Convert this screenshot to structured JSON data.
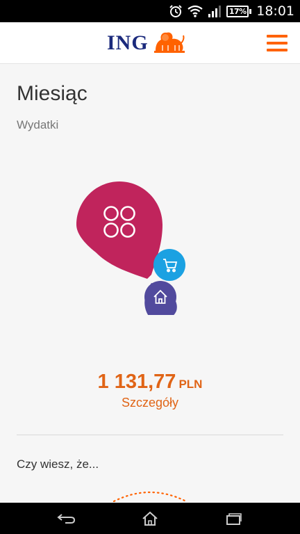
{
  "status_bar": {
    "battery": "17%",
    "time": "18:01",
    "icons": [
      "alarm-icon",
      "wifi-icon",
      "signal-icon",
      "battery-icon"
    ]
  },
  "header": {
    "logo_text": "ING",
    "logo_icon": "lion-icon",
    "menu_icon": "hamburger-icon"
  },
  "main": {
    "title": "Miesiąc",
    "subtitle": "Wydatki",
    "categories": [
      {
        "icon": "grid-icon",
        "color": "#c0245c"
      },
      {
        "icon": "cart-icon",
        "color": "#1ba1e2"
      },
      {
        "icon": "home-icon",
        "color": "#514a9d"
      }
    ],
    "amount_value": "1 131,77",
    "amount_currency": "PLN",
    "details_label": "Szczegóły",
    "did_you_know": "Czy wiesz, że..."
  },
  "nav_bar": {
    "icons": [
      "back-icon",
      "home-nav-icon",
      "recents-icon"
    ]
  },
  "colors": {
    "accent": "#ff6200",
    "brand_blue": "#1b2a7c",
    "amount": "#e06416"
  }
}
